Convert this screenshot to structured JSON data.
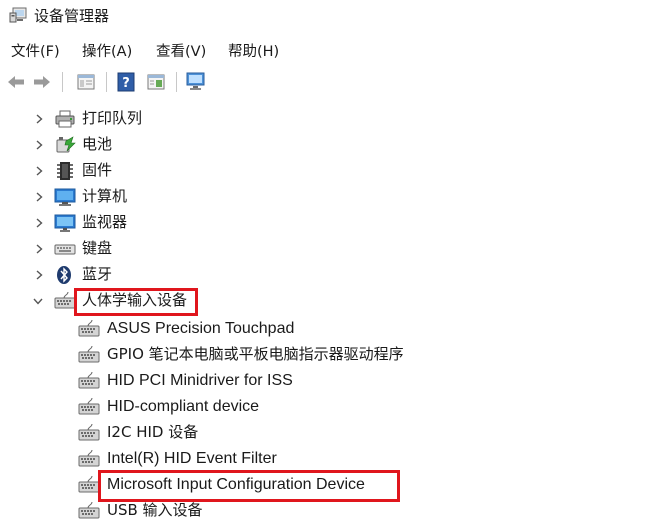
{
  "window": {
    "title": "设备管理器"
  },
  "menu": [
    {
      "label": "文件(F)"
    },
    {
      "label": "操作(A)"
    },
    {
      "label": "查看(V)"
    },
    {
      "label": "帮助(H)"
    }
  ],
  "toolbar": {
    "icons": [
      "back-icon",
      "forward-icon",
      "properties-panel-icon",
      "help-icon",
      "view-icon",
      "scan-hardware-icon"
    ]
  },
  "tree": {
    "categories": [
      {
        "label": "打印队列",
        "icon": "printer-icon",
        "expanded": false
      },
      {
        "label": "电池",
        "icon": "battery-icon",
        "expanded": false
      },
      {
        "label": "固件",
        "icon": "firmware-icon",
        "expanded": false
      },
      {
        "label": "计算机",
        "icon": "computer-icon",
        "expanded": false
      },
      {
        "label": "监视器",
        "icon": "monitor-icon",
        "expanded": false
      },
      {
        "label": "键盘",
        "icon": "keyboard-icon",
        "expanded": false
      },
      {
        "label": "蓝牙",
        "icon": "bluetooth-icon",
        "expanded": false
      },
      {
        "label": "人体学输入设备",
        "icon": "hid-icon",
        "expanded": true,
        "highlighted": true
      }
    ],
    "hid_children": [
      {
        "label": "ASUS Precision Touchpad"
      },
      {
        "label": "GPIO 笔记本电脑或平板电脑指示器驱动程序"
      },
      {
        "label": "HID PCI Minidriver for ISS"
      },
      {
        "label": "HID-compliant device"
      },
      {
        "label": "I2C HID 设备"
      },
      {
        "label": "Intel(R) HID Event Filter"
      },
      {
        "label": "Microsoft Input Configuration Device",
        "highlighted": true
      },
      {
        "label": "USB 输入设备"
      }
    ]
  },
  "colors": {
    "highlight": "#e0161d",
    "icon_blue": "#2b7bd1"
  }
}
